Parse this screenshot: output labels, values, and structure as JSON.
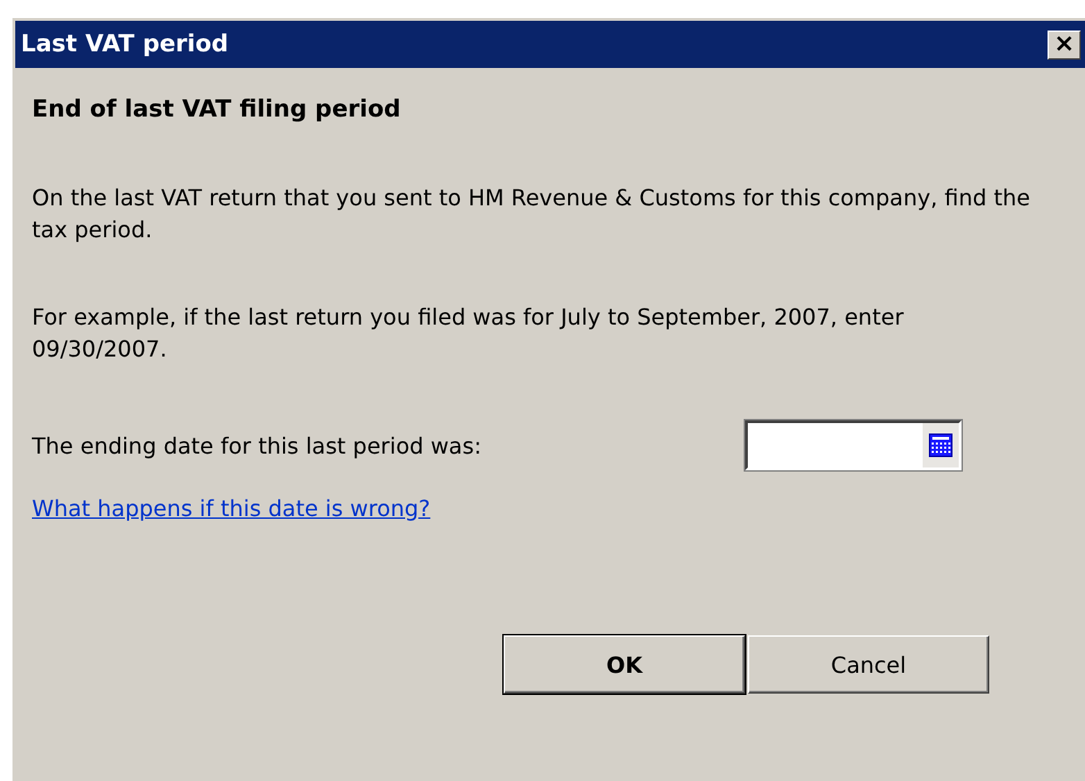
{
  "window": {
    "title": "Last VAT period",
    "close": "×"
  },
  "heading": "End of last VAT filing period",
  "paragraphs": [
    "On the last VAT return that you sent to HM Revenue & Customs for this company, find the tax period.",
    "For example, if the last return you filed was for July to September, 2007, enter 09/30/2007."
  ],
  "date_field": {
    "label": "The ending date for this last period was:"
  },
  "help_link": "What happens if this date is wrong?",
  "buttons": [
    {
      "label": "OK",
      "default": true
    },
    {
      "label": "Cancel",
      "default": false
    }
  ]
}
